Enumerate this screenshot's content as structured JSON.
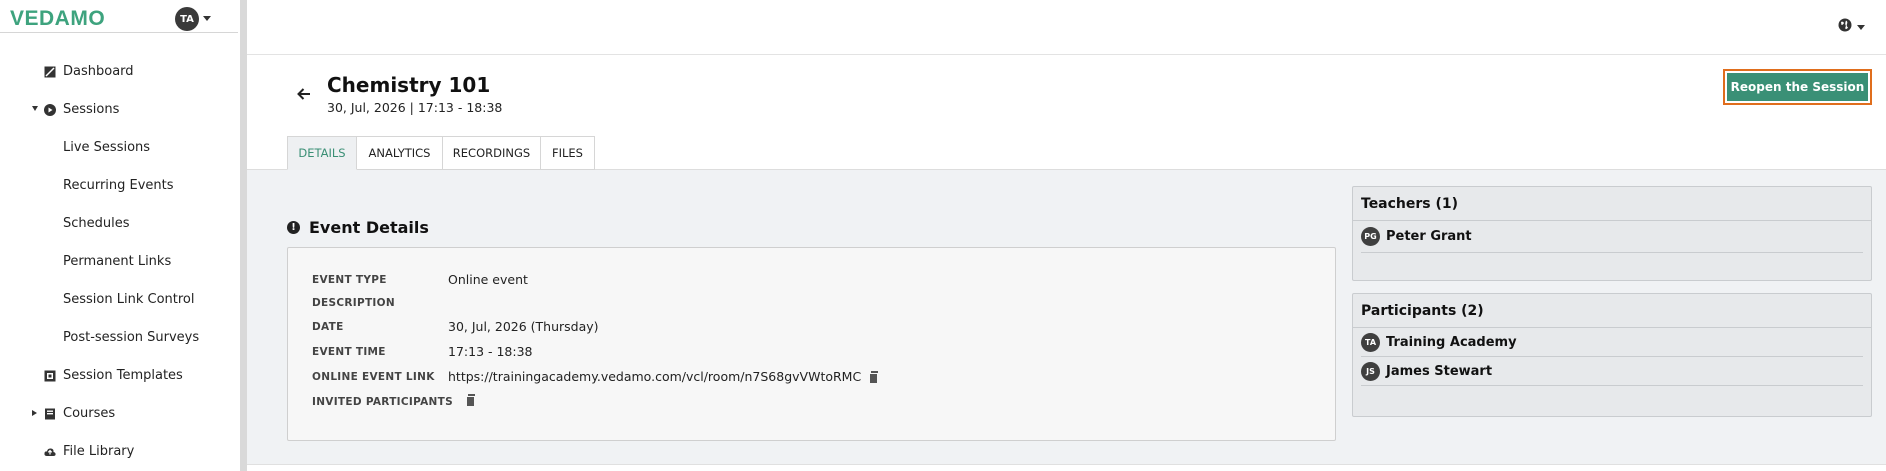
{
  "app": {
    "brand": "VEDAMO",
    "user_initials": "TA"
  },
  "sidebar": {
    "items": [
      {
        "label": "Dashboard",
        "icon": "dashboard-icon"
      },
      {
        "label": "Sessions",
        "icon": "play-circle-icon",
        "expanded": true
      },
      {
        "label": "Live Sessions"
      },
      {
        "label": "Recurring Events"
      },
      {
        "label": "Schedules"
      },
      {
        "label": "Permanent Links"
      },
      {
        "label": "Session Link Control"
      },
      {
        "label": "Post-session Surveys"
      },
      {
        "label": "Session Templates",
        "icon": "template-icon"
      },
      {
        "label": "Courses",
        "icon": "book-icon",
        "expanded": false
      },
      {
        "label": "File Library",
        "icon": "cloud-icon"
      }
    ]
  },
  "topbar": {
    "language_icon": "globe-icon"
  },
  "header": {
    "title": "Chemistry 101",
    "subtitle": "30, Jul, 2026 | 17:13 - 18:38",
    "reopen_label": "Reopen the Session"
  },
  "tabs": [
    {
      "label": "DETAILS",
      "active": true
    },
    {
      "label": "ANALYTICS",
      "active": false
    },
    {
      "label": "RECORDINGS",
      "active": false
    },
    {
      "label": "FILES",
      "active": false
    }
  ],
  "event_details": {
    "title": "Event Details",
    "rows": [
      {
        "label": "EVENT TYPE",
        "value": "Online event"
      },
      {
        "label": "DESCRIPTION",
        "value": ""
      },
      {
        "label": "DATE",
        "value": "30, Jul, 2026 (Thursday)"
      },
      {
        "label": "EVENT TIME",
        "value": "17:13 - 18:38"
      },
      {
        "label": "ONLINE EVENT LINK",
        "value": "https://trainingacademy.vedamo.com/vcl/room/n7S68gvVWtoRMC"
      },
      {
        "label": "INVITED PARTICIPANTS",
        "value": ""
      }
    ]
  },
  "teachers": {
    "title": "Teachers (1)",
    "people": [
      {
        "initials": "PG",
        "name": "Peter Grant"
      }
    ]
  },
  "participants": {
    "title": "Participants (2)",
    "people": [
      {
        "initials": "TA",
        "name": "Training Academy"
      },
      {
        "initials": "JS",
        "name": "James Stewart"
      }
    ]
  },
  "colors": {
    "brand": "#3ea37e",
    "button": "#3a9076",
    "button_outline": "#e06e1d",
    "active_tab_text": "#3a8f75"
  }
}
